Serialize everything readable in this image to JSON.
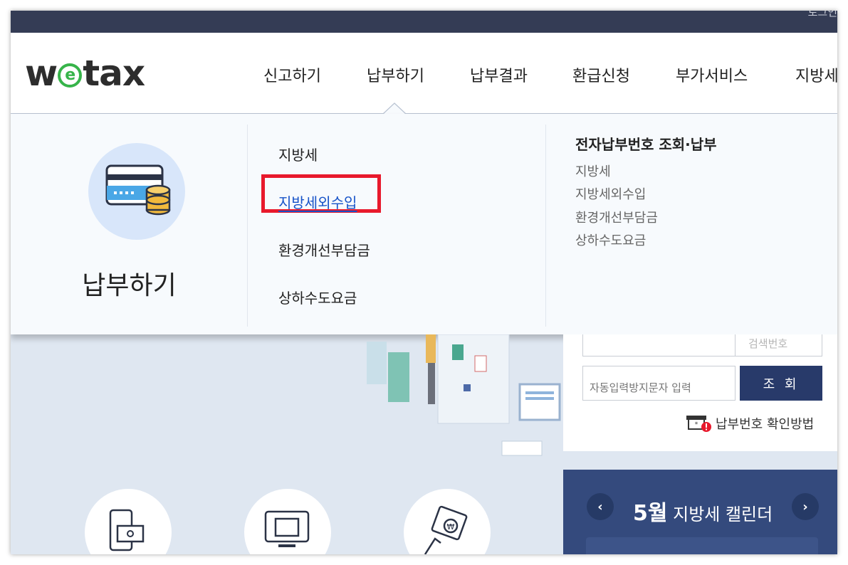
{
  "topbar": {
    "util_text": "로그인"
  },
  "logo": {
    "pre": "w",
    "e": "e",
    "post": "tax"
  },
  "gnb": [
    "신고하기",
    "납부하기",
    "납부결과",
    "환급신청",
    "부가서비스",
    "지방세"
  ],
  "mega": {
    "section_title": "납부하기",
    "middle_items": [
      "지방세",
      "지방세외수입",
      "환경개선부담금",
      "상하수도요금"
    ],
    "active_item": "지방세외수입",
    "right_head": "전자납부번호 조회·납부",
    "right_items": [
      "지방세",
      "지방세외수입",
      "환경개선부담금",
      "상하수도요금"
    ]
  },
  "lookup": {
    "faded_label": "검색번호",
    "captcha_placeholder": "자동입력방지문자 입력",
    "search_button": "조 회",
    "howto_label": "납부번호 확인방법"
  },
  "calendar": {
    "month": "5월",
    "title_rest": " 지방세 캘린더",
    "prev": "‹",
    "next": "›"
  },
  "colors": {
    "topbar": "#343c55",
    "logo_green": "#37b44a",
    "highlight_red": "#e8192c",
    "link_blue": "#1753c8",
    "button_navy": "#283a6a",
    "calendar_bg": "#344a7d"
  }
}
